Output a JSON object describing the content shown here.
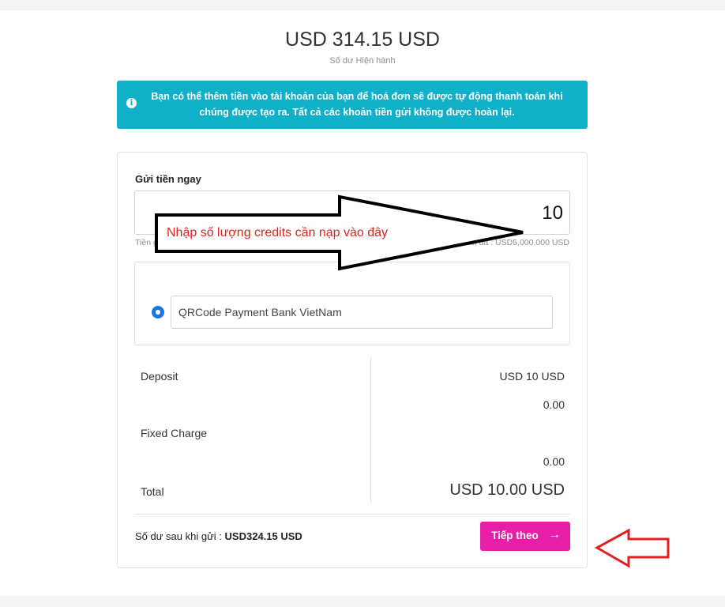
{
  "balance": {
    "amount": "USD 314.15 USD",
    "label": "Số dư Hiện hành"
  },
  "info_box": {
    "icon": "info-icon",
    "text": "Bạn có thể thêm tiền vào tài khoản của bạn để hoá đơn sẽ được tự động thanh toán khi chúng được tạo ra. Tất cả các khoản tiền gửi không được hoàn lại."
  },
  "deposit": {
    "title": "Gửi tiền ngay",
    "amount_value": "10",
    "min_text": "Tiền gửi tối thiểu : USD10.000 USD",
    "max_text": "Tiền gửi tối đa : USD5,000.000 USD"
  },
  "gateway": {
    "selected": true,
    "option_label": "QRCode Payment Bank VietNam"
  },
  "summary": {
    "deposit_label": "Deposit",
    "deposit_value": "USD 10 USD",
    "deposit_sub_value": "0.00",
    "fixed_charge_label": "Fixed Charge",
    "fixed_charge_value": "0.00",
    "total_label": "Total",
    "total_value": "USD 10.00 USD"
  },
  "footer": {
    "balance_after_label": "Số dư sau khi gửi :",
    "balance_after_value": "USD324.15 USD",
    "next_button_label": "Tiếp theo",
    "next_button_icon": "arrow-right-icon"
  },
  "annotation": {
    "text": "Nhập số lượng credits cần nạp vào đây",
    "text_color": "#d9261c",
    "big_arrow_color": "#000000",
    "small_arrow_color": "#e02020"
  },
  "colors": {
    "info_bg": "#0fb0c8",
    "button_bg": "#e91ea8",
    "radio": "#1a73e8"
  }
}
